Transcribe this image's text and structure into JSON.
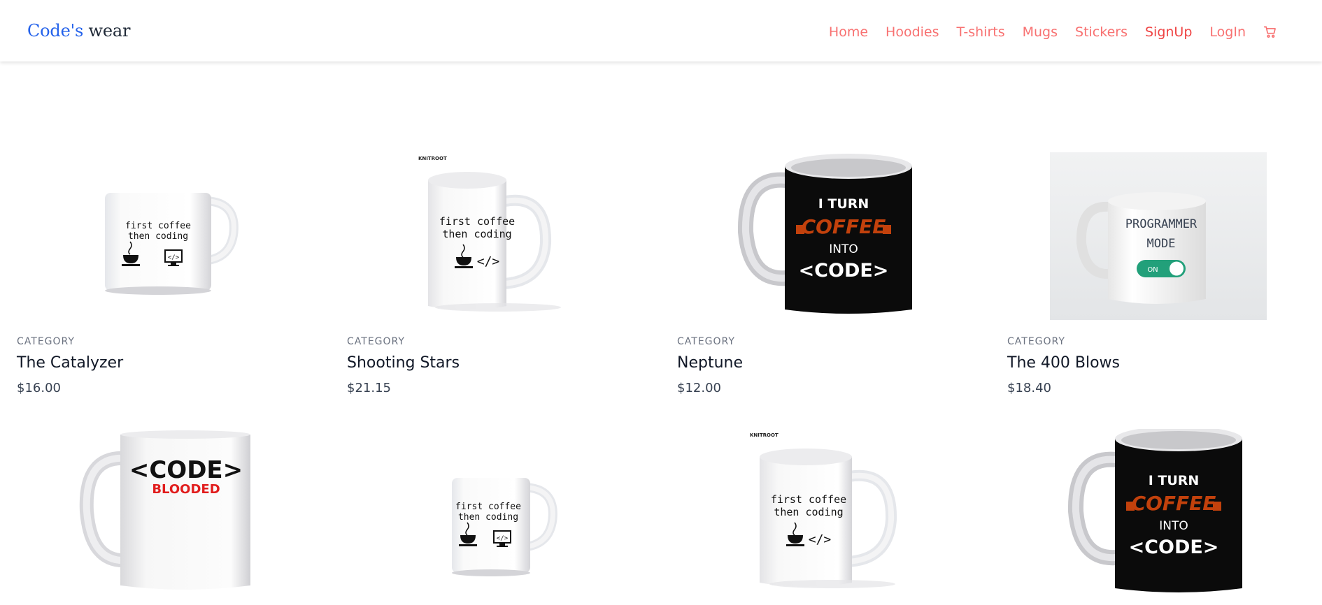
{
  "brand": {
    "part1": "Code's",
    "part2": "wear"
  },
  "nav": {
    "items": [
      {
        "label": "Home"
      },
      {
        "label": "Hoodies"
      },
      {
        "label": "T-shirts"
      },
      {
        "label": "Mugs"
      },
      {
        "label": "Stickers"
      },
      {
        "label": "SignUp"
      },
      {
        "label": "LogIn"
      }
    ],
    "cart_icon": "cart-icon",
    "link_color": "#f87171"
  },
  "products": [
    {
      "category": "CATEGORY",
      "title": "The Catalyzer",
      "price": "$16.00",
      "image": "mug-first-coffee-small"
    },
    {
      "category": "CATEGORY",
      "title": "Shooting Stars",
      "price": "$21.15",
      "image": "mug-first-coffee-knitroot",
      "mark": "KNITROOT",
      "mug_text_1": "first coffee",
      "mug_text_2": "then coding"
    },
    {
      "category": "CATEGORY",
      "title": "Neptune",
      "price": "$12.00",
      "image": "mug-black-coffee-code",
      "mug_lines": [
        "I TURN",
        "COFFEE",
        "INTO",
        "<CODE>"
      ]
    },
    {
      "category": "CATEGORY",
      "title": "The 400 Blows",
      "price": "$18.40",
      "image": "mug-programmer-mode",
      "mug_lines": [
        "PROGRAMMER",
        "MODE",
        "ON"
      ]
    },
    {
      "image": "mug-code-blooded",
      "mug_lines": [
        "<CODE>",
        "BLOODED"
      ]
    },
    {
      "image": "mug-first-coffee-small",
      "mug_text_1": "first coffee",
      "mug_text_2": "then coding"
    },
    {
      "image": "mug-first-coffee-knitroot",
      "mark": "KNITROOT",
      "mug_text_1": "first coffee",
      "mug_text_2": "then coding"
    },
    {
      "image": "mug-black-coffee-code",
      "mug_lines": [
        "I TURN",
        "COFFEE",
        "INTO",
        "<CODE>"
      ]
    }
  ],
  "mug_small_text": [
    "first coffee",
    "then coding"
  ]
}
